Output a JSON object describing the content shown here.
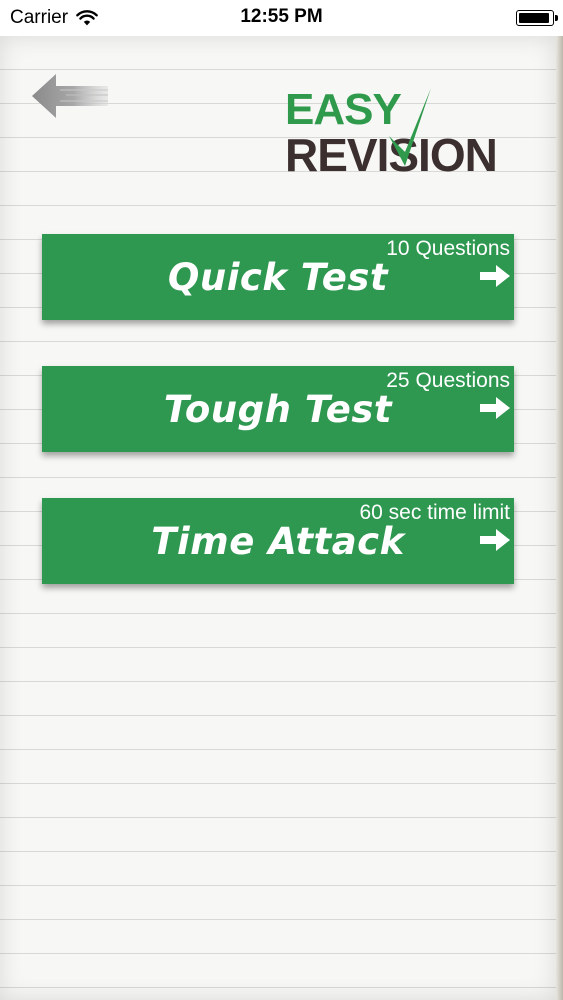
{
  "status_bar": {
    "carrier": "Carrier",
    "time": "12:55 PM",
    "battery_level": 0.95
  },
  "header": {
    "back_icon": "left-arrow-icon",
    "logo_line1": "EASY",
    "logo_line2": "REVISION"
  },
  "modes": [
    {
      "title": "Quick Test",
      "subtitle": "10 Questions",
      "icon": "right-arrow-icon"
    },
    {
      "title": "Tough Test",
      "subtitle": "25 Questions",
      "icon": "right-arrow-icon"
    },
    {
      "title": "Time Attack",
      "subtitle": "60 sec time limit",
      "icon": "right-arrow-icon"
    }
  ],
  "colors": {
    "button_green": "#2e9750",
    "logo_green": "#2f9a4c",
    "logo_brown": "#3c2f2f",
    "paper": "#f7f7f5",
    "paper_lines": "#d8d8d6"
  }
}
